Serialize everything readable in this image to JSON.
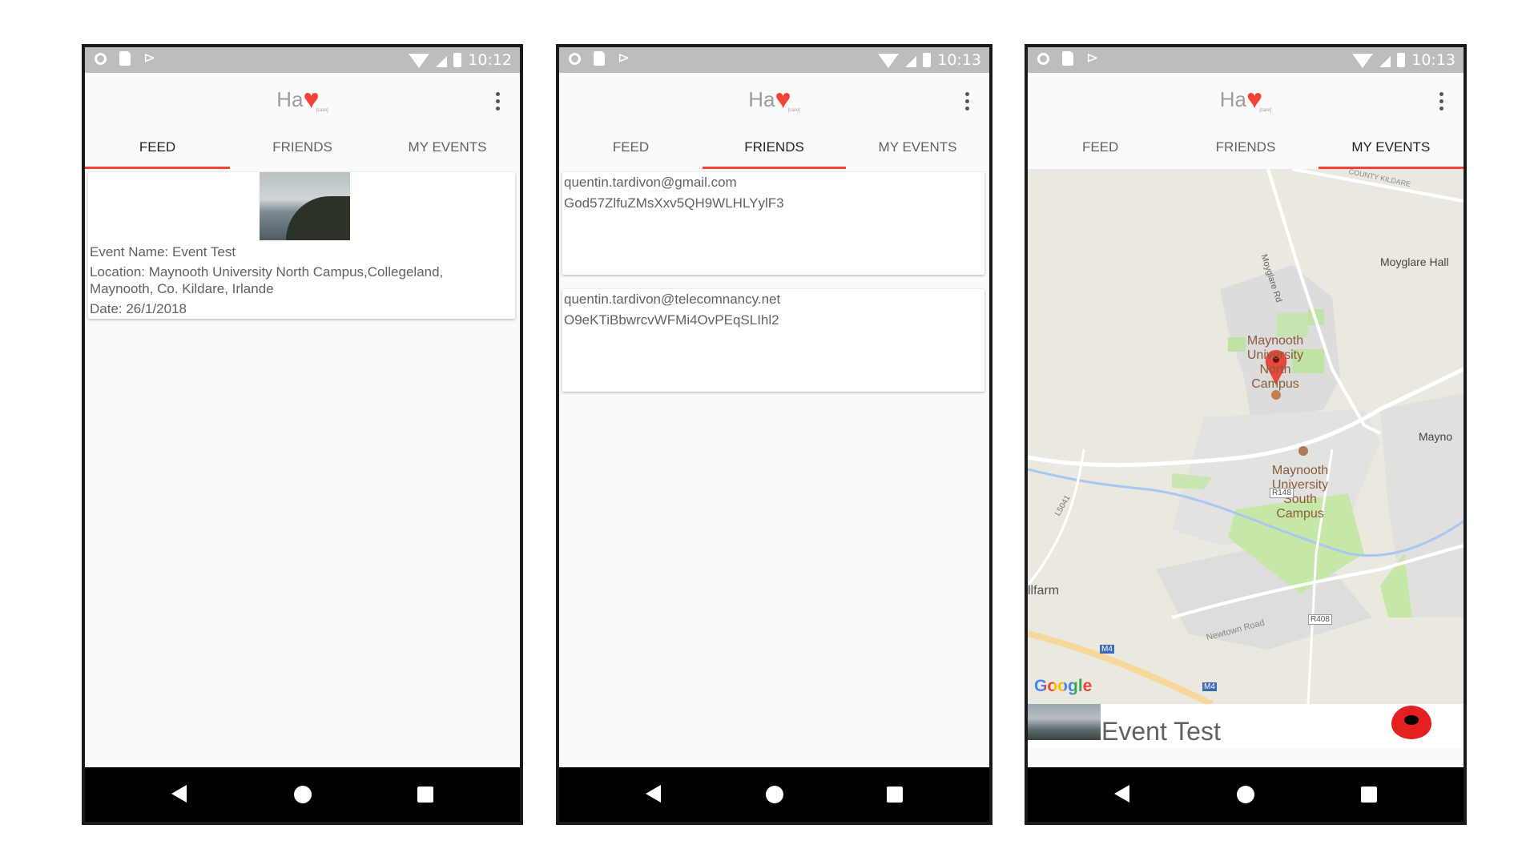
{
  "app": {
    "logo_text": "Ha",
    "logo_heart": "♥",
    "logo_sub": "[care]"
  },
  "tabs": [
    "FEED",
    "FRIENDS",
    "MY EVENTS"
  ],
  "screens": [
    {
      "time": "10:12",
      "active_tab": "FEED"
    },
    {
      "time": "10:13",
      "active_tab": "FRIENDS"
    },
    {
      "time": "10:13",
      "active_tab": "MY EVENTS"
    }
  ],
  "feed": {
    "event_name": "Event Name: Event Test",
    "location": "Location: Maynooth University North Campus,Collegeland, Maynooth, Co. Kildare, Irlande",
    "date": "Date: 26/1/2018"
  },
  "friends": [
    {
      "email": "quentin.tardivon@gmail.com",
      "id": "God57ZlfuZMsXxv5QH9WLHLYylF3"
    },
    {
      "email": "quentin.tardivon@telecomnancy.net",
      "id": "O9eKTiBbwrcvWFMi4OvPEqSLIhl2"
    }
  ],
  "map": {
    "labels": {
      "north_campus_1": "Maynooth",
      "north_campus_2": "University",
      "north_campus_3": "North Campus",
      "south_campus_1": "Maynooth",
      "south_campus_2": "University",
      "south_campus_3": "South Campus",
      "moyglare_hall": "Moyglare Hall",
      "moyglare_rd": "Moyglare Rd",
      "maynooth_edge": "Mayno",
      "county_kildare": "COUNTY KILDARE",
      "r148": "R148",
      "r408": "R408",
      "l5041": "L5041",
      "newtown_road": "Newtown Road",
      "m4_a": "M4",
      "m4_b": "M4",
      "illfarm": "llfarm",
      "google": "Google"
    }
  },
  "my_events": {
    "event_title": "Event Test"
  },
  "colors": {
    "accent": "#f44336",
    "status_bar": "#bdbdbd",
    "nav_bar": "#000000",
    "marker": "#e52020"
  }
}
